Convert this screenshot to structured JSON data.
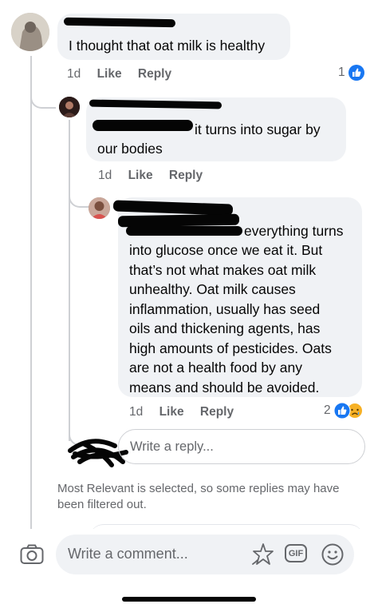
{
  "comments": [
    {
      "text": "I thought that oat milk is healthy",
      "time": "1d",
      "like_label": "Like",
      "reply_label": "Reply",
      "reaction_count": "1"
    },
    {
      "text_visible": "it turns  into sugar by",
      "text_line2": "our bodies",
      "time": "1d",
      "like_label": "Like",
      "reply_label": "Reply"
    },
    {
      "text_first": "everything turns",
      "text_lines": [
        "into glucose once we eat it. But",
        "that’s not what makes oat milk",
        "unhealthy. Oat milk causes",
        "inflammation, usually has seed",
        "oils and thickening agents, has",
        "high amounts of pesticides. Oats",
        "are not a health food by any",
        "means and should be avoided."
      ],
      "time": "1d",
      "like_label": "Like",
      "reply_label": "Reply",
      "reaction_count": "2"
    }
  ],
  "reply_box": {
    "placeholder": "Write a reply..."
  },
  "filter_notice": "Most Relevant is selected, so some replies may have been filtered out.",
  "composer": {
    "placeholder": "Write a comment...",
    "gif_label": "GIF"
  },
  "icons": {
    "camera": "camera-icon",
    "sticker": "sticker-icon",
    "gif": "gif-icon",
    "emoji": "emoji-icon",
    "like": "like-reaction-icon",
    "sad": "sad-reaction-icon"
  },
  "colors": {
    "like_blue": "#1877f2",
    "bubble": "#f0f2f5",
    "meta_gray": "#65676b"
  }
}
